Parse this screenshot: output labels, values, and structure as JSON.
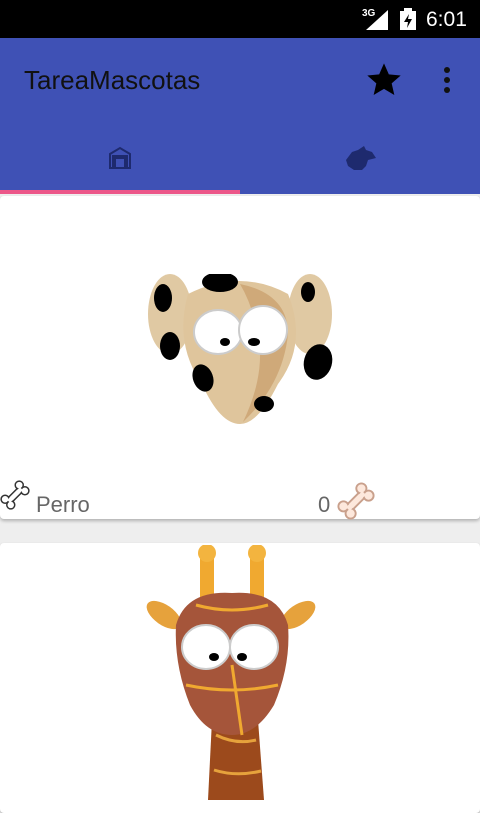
{
  "status_bar": {
    "network": "3G",
    "time": "6:01"
  },
  "app_bar": {
    "title": "TareaMascotas"
  },
  "tabs": [
    {
      "icon": "house-icon",
      "selected": true
    },
    {
      "icon": "dog-icon",
      "selected": false
    }
  ],
  "colors": {
    "primary": "#3f51b5",
    "accent": "#ec5789",
    "background": "#eeeeee"
  },
  "pets": [
    {
      "name": "Perro",
      "likes": "0",
      "image": "dog-image"
    },
    {
      "name": "",
      "likes": "",
      "image": "giraffe-image"
    }
  ]
}
